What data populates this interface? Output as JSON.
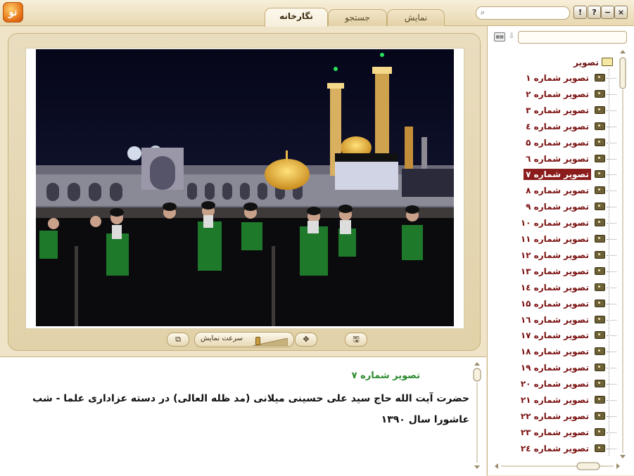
{
  "logo": {
    "glyph": "نو"
  },
  "tabs": [
    {
      "label": "نگارخانه",
      "active": true
    },
    {
      "label": "جستجو",
      "active": false
    },
    {
      "label": "نمایش",
      "active": false
    }
  ],
  "search": {
    "placeholder": "",
    "value": ""
  },
  "window_buttons": [
    "!",
    "?",
    "−",
    "×"
  ],
  "controls": {
    "speed_label": "سرعت نمایش",
    "speed_level": 0.1
  },
  "caption": {
    "title": "تصویر شماره ۷",
    "text": "حضرت آیت الله حاج سید علی حسینی میلانی (مد ظله العالی) در دسته عزاداری علما - شب عاشورا سال ۱۳۹۰"
  },
  "tree": {
    "root_label": "تصویر",
    "selected_index": 6,
    "items": [
      "تصویر شماره ۱",
      "تصویر شماره ۲",
      "تصویر شماره ۳",
      "تصویر شماره ٤",
      "تصویر شماره ۵",
      "تصویر شماره ٦",
      "تصویر شماره ۷",
      "تصویر شماره ۸",
      "تصویر شماره ۹",
      "تصویر شماره ۱۰",
      "تصویر شماره ۱۱",
      "تصویر شماره ۱۲",
      "تصویر شماره ۱۳",
      "تصویر شماره ۱٤",
      "تصویر شماره ۱۵",
      "تصویر شماره ۱٦",
      "تصویر شماره ۱۷",
      "تصویر شماره ۱۸",
      "تصویر شماره ۱۹",
      "تصویر شماره ۲۰",
      "تصویر شماره ۲۱",
      "تصویر شماره ۲۲",
      "تصویر شماره ۲۳",
      "تصویر شماره ۲٤"
    ]
  },
  "colors": {
    "accent": "#8a1c1c",
    "caption_title": "#2b8a2e",
    "background": "#efe4c8"
  }
}
